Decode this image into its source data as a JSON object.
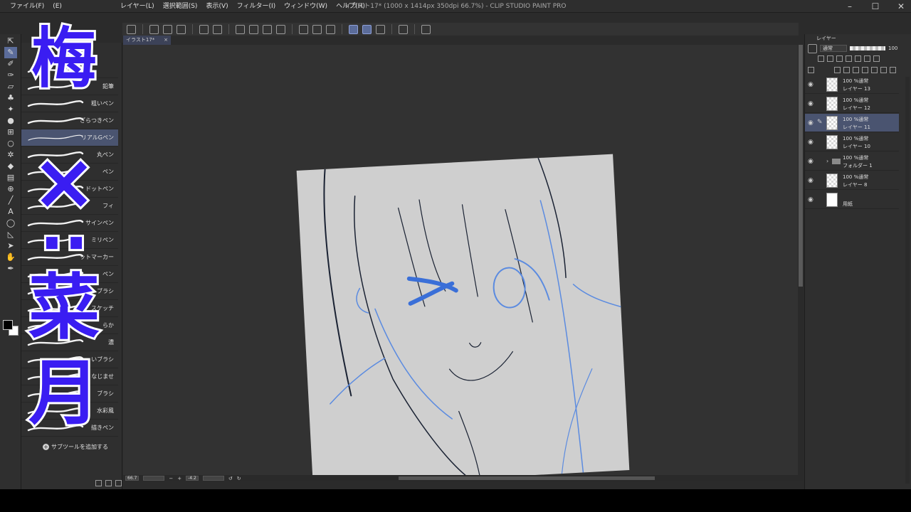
{
  "app": {
    "title": "イラスト17* (1000 x 1414px 350dpi 66.7%) - CLIP STUDIO PAINT PRO",
    "menu": [
      "ファイル(F)",
      "(E)",
      "レイヤー(L)",
      "選択範囲(S)",
      "表示(V)",
      "フィルター(I)",
      "ウィンドウ(W)",
      "ヘルプ(H)"
    ],
    "win_controls": {
      "minimize": "–",
      "maximize": "☐",
      "close": "✕"
    }
  },
  "canvas": {
    "tab_title": "イラスト17*",
    "tab_close": "×",
    "paper_color": "#cfcfcf"
  },
  "subtool": {
    "brushes": [
      {
        "name": "",
        "selected": false
      },
      {
        "name": "鉛筆",
        "selected": false
      },
      {
        "name": "粗いペン",
        "selected": false
      },
      {
        "name": "ざらつきペン",
        "selected": false
      },
      {
        "name": "リアルGペン",
        "selected": true
      },
      {
        "name": "丸ペン",
        "selected": false
      },
      {
        "name": "ペン",
        "selected": false
      },
      {
        "name": "ドットペン",
        "selected": false
      },
      {
        "name": "フィ",
        "selected": false
      },
      {
        "name": "サインペン",
        "selected": false
      },
      {
        "name": "ミリペン",
        "selected": false
      },
      {
        "name": "ットマーカー",
        "selected": false
      },
      {
        "name": "ペン",
        "selected": false
      },
      {
        "name": "ブラシ",
        "selected": false
      },
      {
        "name": "スケッチ",
        "selected": false
      },
      {
        "name": "らか",
        "selected": false
      },
      {
        "name": "濃",
        "selected": false
      },
      {
        "name": "いブラシ",
        "selected": false
      },
      {
        "name": "なじませ",
        "selected": false
      },
      {
        "name": "ブラシ",
        "selected": false
      },
      {
        "name": "水彩風",
        "selected": false
      },
      {
        "name": "描きペン",
        "selected": false
      }
    ],
    "add_label": "サブツールを追加する"
  },
  "layers": {
    "tab_label": "レイヤー",
    "blend_mode": "通常",
    "opacity": "100",
    "items": [
      {
        "line1": "100 %通常",
        "line2": "レイヤー 13",
        "type": "layer",
        "selected": false
      },
      {
        "line1": "100 %通常",
        "line2": "レイヤー 12",
        "type": "layer",
        "selected": false
      },
      {
        "line1": "100 %通常",
        "line2": "レイヤー 11",
        "type": "layer",
        "selected": true
      },
      {
        "line1": "100 %通常",
        "line2": "レイヤー 10",
        "type": "layer",
        "selected": false
      },
      {
        "line1": "100 %通常",
        "line2": "フォルダー 1",
        "type": "folder",
        "selected": false
      },
      {
        "line1": "100 %通常",
        "line2": "レイヤー 8",
        "type": "layer",
        "selected": false
      },
      {
        "line1": "",
        "line2": "用紙",
        "type": "paper",
        "selected": false
      }
    ]
  },
  "status": {
    "zoom": "66.7",
    "angle": "-4.2"
  },
  "overlay": {
    "char1": "梅",
    "char2": "×",
    "char3": "⋅⋅",
    "char4": "菜",
    "char5": "月",
    "color": "#3a1df2"
  },
  "icons": {
    "eye": "eye-icon",
    "pen": "pen-icon",
    "folder": "folder-icon"
  }
}
